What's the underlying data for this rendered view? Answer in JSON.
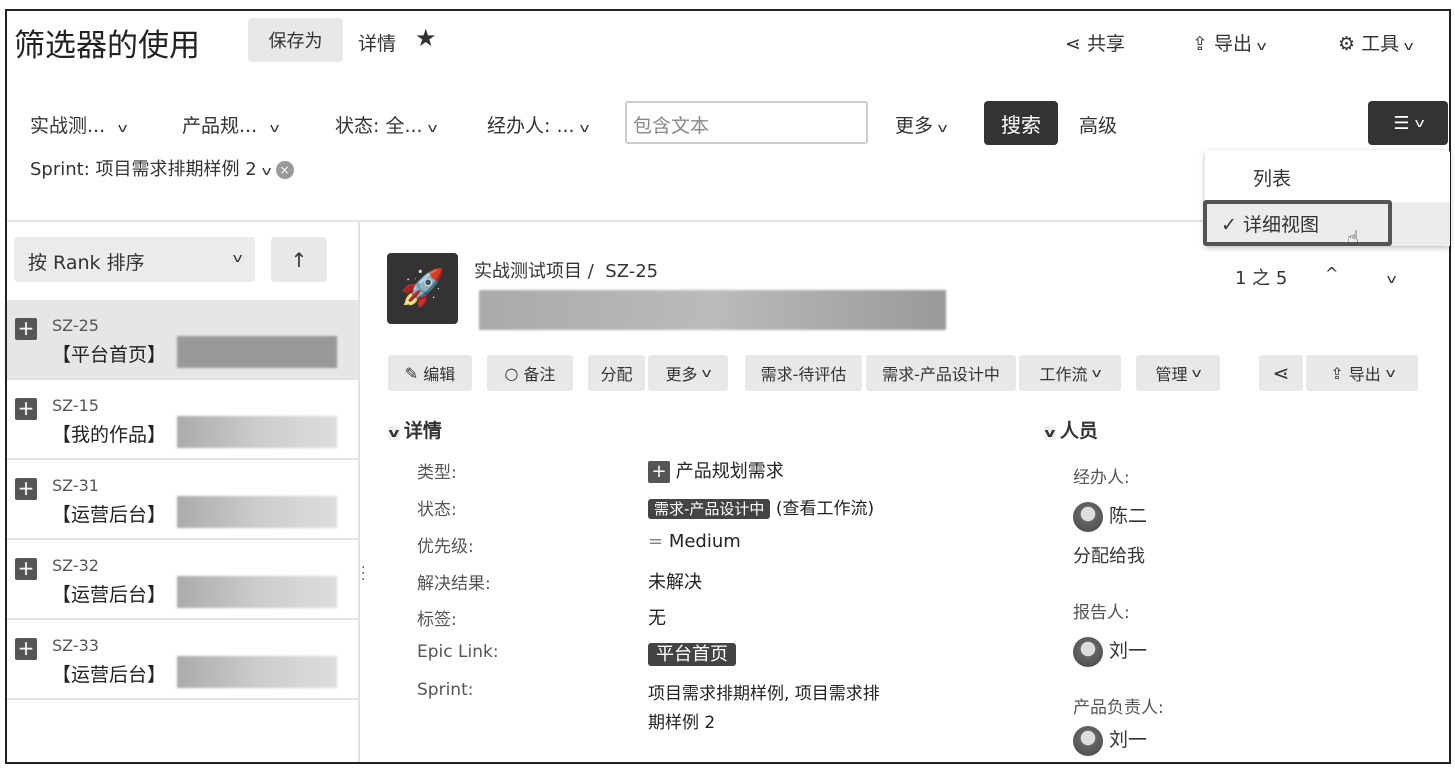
{
  "header": {
    "title": "筛选器的使用",
    "save_as": "保存为",
    "details": "详情",
    "share": "共享",
    "export": "导出",
    "tools": "工具"
  },
  "filters": {
    "project": "实战测...",
    "type": "产品规...",
    "status": "状态: 全...",
    "assignee": "经办人: ...",
    "text_placeholder": "包含文本",
    "more": "更多",
    "search": "搜索",
    "advanced": "高级",
    "sprint": "Sprint: 项目需求排期样例 2"
  },
  "view_menu": {
    "items": [
      {
        "label": "列表"
      },
      {
        "label": "详细视图",
        "checked": true
      }
    ]
  },
  "sidebar": {
    "sort": "按 Rank 排序",
    "items": [
      {
        "key": "SZ-25",
        "summary": "【平台首页】",
        "selected": true
      },
      {
        "key": "SZ-15",
        "summary": "【我的作品】"
      },
      {
        "key": "SZ-31",
        "summary": "【运营后台】"
      },
      {
        "key": "SZ-32",
        "summary": "【运营后台】"
      },
      {
        "key": "SZ-33",
        "summary": "【运营后台】"
      }
    ]
  },
  "issue": {
    "project": "实战测试项目",
    "separator": "/",
    "key": "SZ-25",
    "pager": "1 之 5",
    "actions": {
      "edit": "编辑",
      "comment": "备注",
      "assign": "分配",
      "more": "更多",
      "t1": "需求-待评估",
      "t2": "需求-产品设计中",
      "workflow": "工作流",
      "admin": "管理",
      "export": "导出"
    },
    "details": {
      "title": "详情",
      "type_label": "类型:",
      "type": "产品规划需求",
      "status_label": "状态:",
      "status": "需求-产品设计中",
      "status_link": "(查看工作流)",
      "priority_label": "优先级:",
      "priority": "Medium",
      "resolution_label": "解决结果:",
      "resolution": "未解决",
      "labels_label": "标签:",
      "labels": "无",
      "epic_label": "Epic Link:",
      "epic": "平台首页",
      "sprint_label": "Sprint:",
      "sprint_l1": "项目需求排期样例, 项目需求排",
      "sprint_l2": "期样例 2"
    },
    "people": {
      "title": "人员",
      "assignee_label": "经办人:",
      "assignee": "陈二",
      "assign_me": "分配给我",
      "reporter_label": "报告人:",
      "reporter": "刘一",
      "owner_label": "产品负责人:",
      "owner": "刘一"
    }
  }
}
